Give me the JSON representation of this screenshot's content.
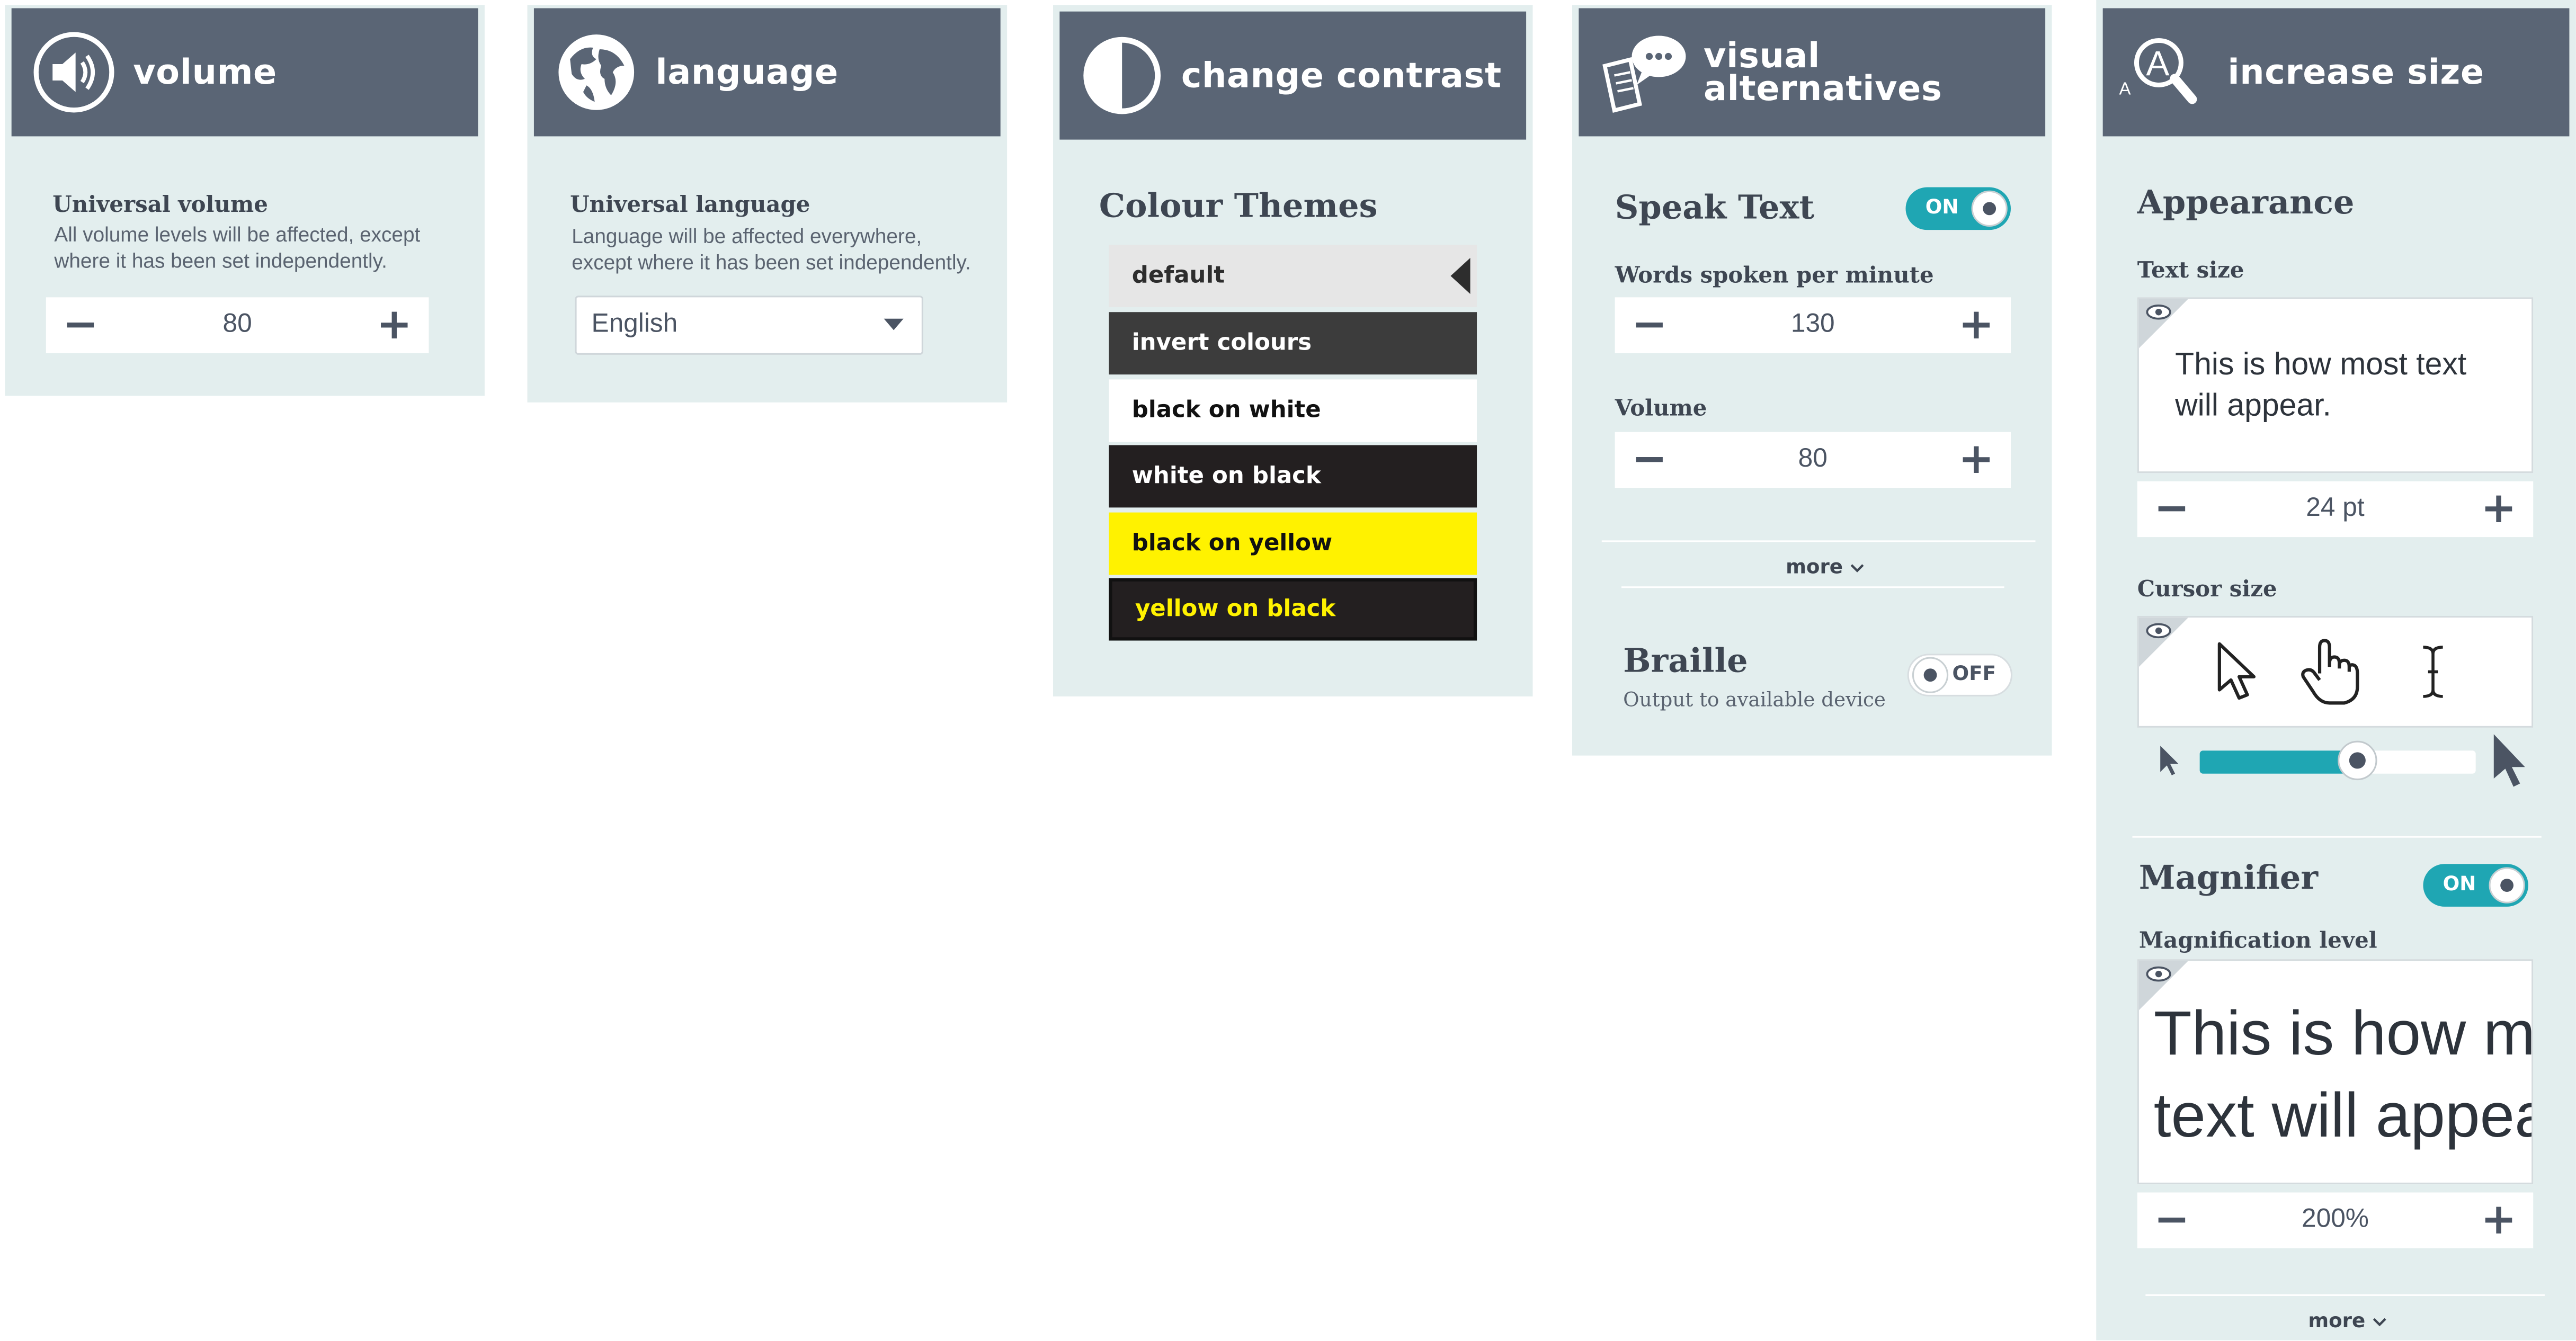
{
  "volume_panel": {
    "title": "volume",
    "icon": "speaker-icon",
    "label": "Universal volume",
    "description_line1": "All volume levels will be affected, except",
    "description_line2": "where it has been set independently.",
    "value": "80",
    "minus": "−",
    "plus": "+"
  },
  "language_panel": {
    "title": "language",
    "icon": "globe-icon",
    "label": "Universal language",
    "description_line1": "Language will be affected everywhere,",
    "description_line2": "except where it has been set independently.",
    "selected": "English"
  },
  "contrast_panel": {
    "title": "change contrast",
    "icon": "half-circle-icon",
    "heading": "Colour Themes",
    "themes": [
      {
        "label": "default",
        "bg": "#e6e6e6",
        "fg": "#2d2d2d"
      },
      {
        "label": "invert colours",
        "bg": "#3c3c3c",
        "fg": "#ffffff"
      },
      {
        "label": "black on white",
        "bg": "#ffffff",
        "fg": "#111111"
      },
      {
        "label": "white on black",
        "bg": "#231f20",
        "fg": "#ffffff"
      },
      {
        "label": "black on yellow",
        "bg": "#fff200",
        "fg": "#111111"
      },
      {
        "label": "yellow on black",
        "bg": "#231f20",
        "fg": "#fff200"
      }
    ]
  },
  "visual_panel": {
    "title_line1": "visual",
    "title_line2": "alternatives",
    "icon": "speech-bubble-document-icon",
    "speak_text": "Speak Text",
    "speak_toggle": "ON",
    "words_label": "Words spoken per minute",
    "words_value": "130",
    "volume_label": "Volume",
    "volume_value": "80",
    "more": "more",
    "braille": "Braille",
    "braille_desc": "Output to available device",
    "braille_toggle": "OFF",
    "minus": "−",
    "plus": "+"
  },
  "size_panel": {
    "title": "increase size",
    "icon": "magnifier-letter-icon",
    "icon_letter_small": "A",
    "icon_letter_big": "A",
    "appearance": "Appearance",
    "text_size_label": "Text size",
    "preview_line1": "This is how most text",
    "preview_line2": "will appear.",
    "text_size_value": "24 pt",
    "cursor_size_label": "Cursor size",
    "cursor_slider_fraction": 0.57,
    "magnifier": "Magnifier",
    "magnifier_toggle": "ON",
    "magnification_label": "Magnification level",
    "mag_preview_line1": "This is how most",
    "mag_preview_line2": "text will appear.",
    "magnification_value": "200%",
    "more": "more",
    "minus": "−",
    "plus": "+"
  },
  "colors": {
    "header_bg": "#5a6575",
    "panel_bg": "#e3eeee",
    "accent": "#1fa6b3",
    "text": "#3e4652"
  }
}
